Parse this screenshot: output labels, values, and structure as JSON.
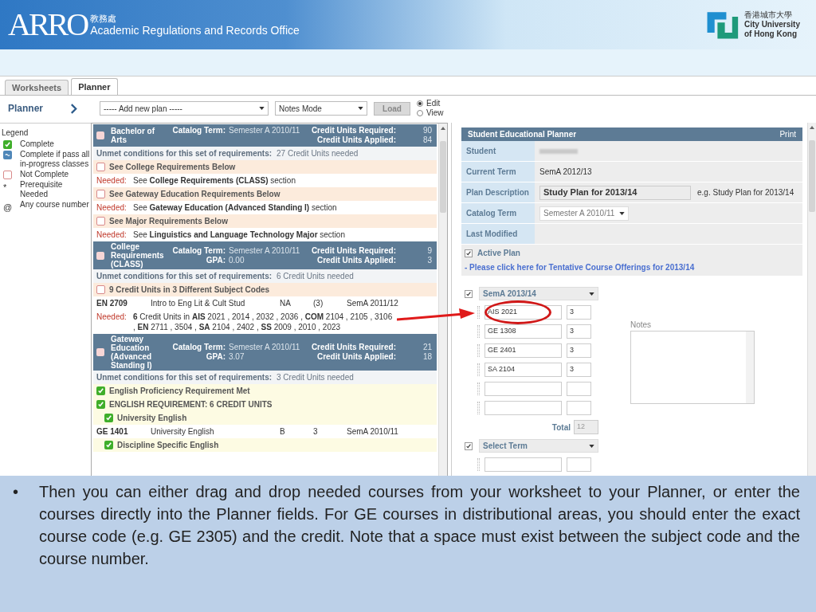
{
  "header": {
    "logo_text": "ARRO",
    "office_chinese": "教務處",
    "office_name": "Academic Regulations and Records Office",
    "university_chinese": "香港城市大學",
    "university_lines": [
      "City University",
      "of Hong Kong"
    ]
  },
  "tabs": [
    {
      "label": "Worksheets",
      "selected": false
    },
    {
      "label": "Planner",
      "selected": true
    }
  ],
  "toolbar": {
    "title": "Planner",
    "plan_select": "----- Add new plan -----",
    "mode_select": "Notes Mode",
    "load_button": "Load",
    "modes": [
      {
        "label": "Edit",
        "selected": true
      },
      {
        "label": "View",
        "selected": false
      }
    ]
  },
  "legend": {
    "title": "Legend",
    "items": [
      {
        "kind": "complete",
        "label": "Complete"
      },
      {
        "kind": "in_progress",
        "label": "Complete if pass all in-progress classes"
      },
      {
        "kind": "not_complete",
        "label": "Not Complete"
      },
      {
        "kind": "symbol",
        "symbol": "*",
        "label": "Prerequisite Needed"
      },
      {
        "kind": "symbol",
        "symbol": "@",
        "label": "Any course number"
      }
    ]
  },
  "blocks": [
    {
      "title": "Bachelor of Arts",
      "complete": false,
      "catalog_label": "Catalog Term:",
      "catalog_term": "Semester A 2010/11",
      "required_label": "Credit Units Required:",
      "required": "90",
      "applied_label": "Credit Units Applied:",
      "applied": "84",
      "unmet_label": "Unmet conditions for this set of requirements:",
      "unmet": "27 Credit Units needed",
      "rows": [
        {
          "kind": "requirement",
          "complete": false,
          "text": "See College Requirements Below"
        },
        {
          "kind": "needed",
          "label": "Needed:",
          "text": "See **College Requirements (CLASS)** section"
        },
        {
          "kind": "requirement",
          "complete": false,
          "text": "See Gateway Education Requirements Below"
        },
        {
          "kind": "needed",
          "label": "Needed:",
          "text": "See **Gateway Education (Advanced Standing I)** section"
        },
        {
          "kind": "requirement",
          "complete": false,
          "text": "See Major Requirements Below"
        },
        {
          "kind": "needed",
          "label": "Needed:",
          "text": "See **Linguistics and Language Technology Major** section"
        }
      ]
    },
    {
      "title": "College Requirements (CLASS)",
      "complete": false,
      "catalog_label": "Catalog Term:",
      "catalog_term": "Semester A 2010/11",
      "gpa_label": "GPA:",
      "gpa": "0.00",
      "required_label": "Credit Units Required:",
      "required": "9",
      "applied_label": "Credit Units Applied:",
      "applied": "3",
      "unmet_label": "Unmet conditions for this set of requirements:",
      "unmet": "6 Credit Units needed",
      "rows": [
        {
          "kind": "requirement",
          "complete": false,
          "text": "9 Credit Units in 3 Different Subject Codes"
        },
        {
          "kind": "course",
          "code": "EN 2709",
          "title": "Intro to Eng Lit & Cult Stud",
          "grade": "NA",
          "units": "(3)",
          "term": "SemA 2011/12"
        },
        {
          "kind": "needed",
          "label": "Needed:",
          "text": "**6** Credit Units in **AIS** 2021 , 2014 , 2032 , 2036 , **COM** 2104 , 2105 , 3106 , **EN** 2711 , 3504 , **SA** 2104 , 2402 , **SS** 2009 , 2010 , 2023"
        }
      ]
    },
    {
      "title": "Gateway Education (Advanced Standing I)",
      "complete": false,
      "catalog_label": "Catalog Term:",
      "catalog_term": "Semester A 2010/11",
      "gpa_label": "GPA:",
      "gpa": "3.07",
      "required_label": "Credit Units Required:",
      "required": "21",
      "applied_label": "Credit Units Applied:",
      "applied": "18",
      "unmet_label": "Unmet conditions for this set of requirements:",
      "unmet": "3 Credit Units needed",
      "rows": [
        {
          "kind": "requirement",
          "complete": true,
          "text": "English Proficiency Requirement Met"
        },
        {
          "kind": "requirement",
          "complete": true,
          "text": "ENGLISH REQUIREMENT: 6 CREDIT UNITS",
          "children": [
            {
              "kind": "requirement",
              "complete": true,
              "text": "University English",
              "children": [
                {
                  "kind": "course",
                  "code": "GE 1401",
                  "title": "University English",
                  "grade": "B",
                  "units": "3",
                  "term": "SemA 2010/11"
                }
              ]
            },
            {
              "kind": "requirement",
              "complete": true,
              "text": "Discipline Specific English"
            }
          ]
        }
      ]
    }
  ],
  "planner": {
    "title": "Student Educational Planner",
    "print": "Print",
    "fields": [
      {
        "kind": "blurred",
        "label": "Student"
      },
      {
        "kind": "text",
        "label": "Current Term",
        "value": "SemA 2012/13"
      },
      {
        "kind": "input",
        "label": "Plan Description",
        "value": "Study Plan for 2013/14",
        "hint": "e.g. Study Plan for 2013/14"
      },
      {
        "kind": "select",
        "label": "Catalog Term",
        "value": "Semester A 2010/11"
      },
      {
        "kind": "text",
        "label": "Last Modified"
      }
    ],
    "active_plan": {
      "label": "Active Plan",
      "checked": true
    },
    "link": "- Please click here for Tentative Course Offerings for 2013/14",
    "notes_label": "Notes",
    "terms": [
      {
        "name": "SemA 2013/14",
        "checked": true,
        "total_label": "Total",
        "total": "12",
        "courses": [
          {
            "kind": "filled",
            "code": "AIS 2021",
            "units": "3",
            "highlighted": true
          },
          {
            "kind": "filled",
            "code": "GE 1308",
            "units": "3",
            "highlighted": false
          },
          {
            "kind": "filled",
            "code": "GE 2401",
            "units": "3",
            "highlighted": false
          },
          {
            "kind": "filled",
            "code": "SA 2104",
            "units": "3",
            "highlighted": false
          },
          {
            "kind": "blank"
          },
          {
            "kind": "blank"
          }
        ]
      },
      {
        "name": "Select Term",
        "checked": true,
        "courses": [
          {
            "kind": "blank"
          }
        ]
      }
    ]
  },
  "caption": {
    "bullet": "•",
    "text": "Then you can either drag and drop needed courses from your worksheet to your Planner, or enter the courses directly into the Planner fields. For GE courses in distributional areas, you should enter the exact course code (e.g. GE 2305) and the credit. Note that a space must exist between the subject code and the course number."
  }
}
